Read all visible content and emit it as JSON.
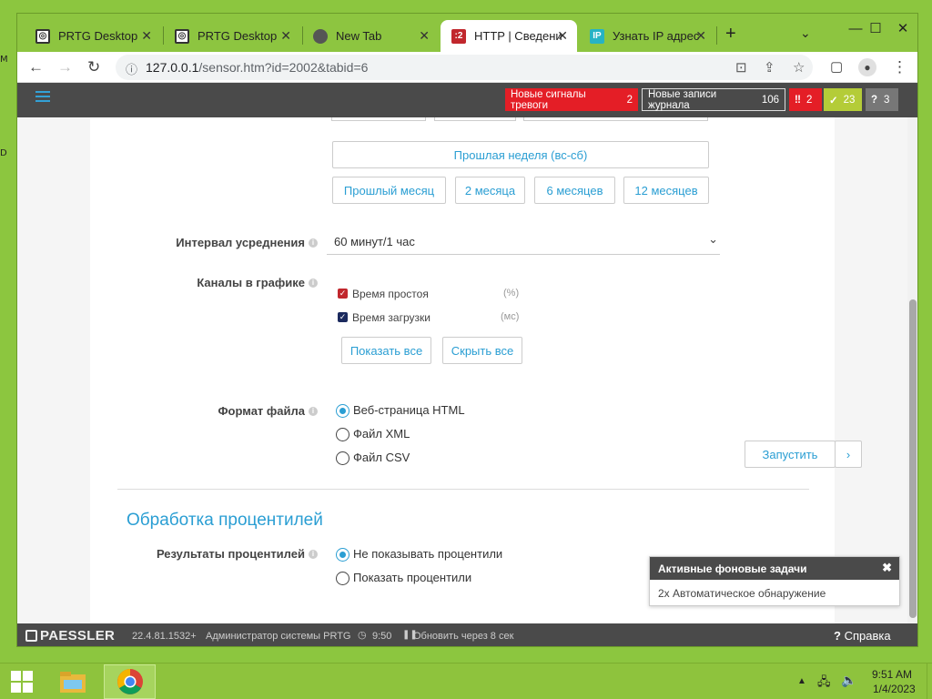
{
  "desktop": {
    "marks": [
      "M",
      "D"
    ]
  },
  "browser": {
    "tabs": [
      {
        "label": "PRTG Desktop",
        "icon": "prtg-icon",
        "active": false
      },
      {
        "label": "PRTG Desktop",
        "icon": "prtg-icon",
        "active": false
      },
      {
        "label": "New Tab",
        "icon": "chrome-icon",
        "active": false
      },
      {
        "label": "HTTP | Сведени",
        "icon": "prtg-sensor-icon",
        "active": true
      },
      {
        "label": "Узнать IP адрес",
        "icon": "ip-icon",
        "active": false
      }
    ],
    "new_tab": "+",
    "url": {
      "host": "127.0.0.1",
      "path": "/sensor.htm?id=2002&tabid=6"
    }
  },
  "topbar": {
    "alarms": {
      "label": "Новые сигналы тревоги",
      "count": "2"
    },
    "log": {
      "label": "Новые записи журнала",
      "count": "106"
    },
    "down": "2",
    "ok": "23",
    "unknown": "3",
    "colors": {
      "alarm": "#e41e26",
      "ok": "#b4cc38",
      "unknown": "#777777",
      "accent": "#2a9ed3"
    }
  },
  "period": {
    "last_week": "Прошлая неделя (вс-сб)",
    "last_month": "Прошлый месяц",
    "two_months": "2 месяца",
    "six_months": "6 месяцев",
    "twelve_months": "12 месяцев"
  },
  "averaging": {
    "label": "Интервал усреднения",
    "value": "60 минут/1 час"
  },
  "channels": {
    "label": "Каналы в графике",
    "items": [
      {
        "name": "Время простоя",
        "unit": "(%)",
        "checked": true,
        "color": "#c1272d"
      },
      {
        "name": "Время загрузки",
        "unit": "(мс)",
        "checked": true,
        "color": "#1b2a5e"
      }
    ],
    "show_all": "Показать все",
    "hide_all": "Скрыть все"
  },
  "file_format": {
    "label": "Формат файла",
    "options": [
      "Веб-страница HTML",
      "Файл XML",
      "Файл CSV"
    ],
    "selected": 0
  },
  "run": {
    "label": "Запустить",
    "arrow": "›"
  },
  "percentiles": {
    "section_title": "Обработка процентилей",
    "label": "Результаты процентилей",
    "options": [
      "Не показывать процентили",
      "Показать процентили"
    ],
    "selected": 0
  },
  "notification": {
    "title": "Активные фоновые задачи",
    "body": "2x Автоматическое обнаружение"
  },
  "footer": {
    "brand": "PAESSLER",
    "version": "22.4.81.1532+",
    "user": "Администратор системы PRTG",
    "time": "9:50",
    "refresh": "Обновить через 8 сек",
    "help": "Справка"
  },
  "taskbar": {
    "time": "9:51 AM",
    "date": "1/4/2023"
  }
}
